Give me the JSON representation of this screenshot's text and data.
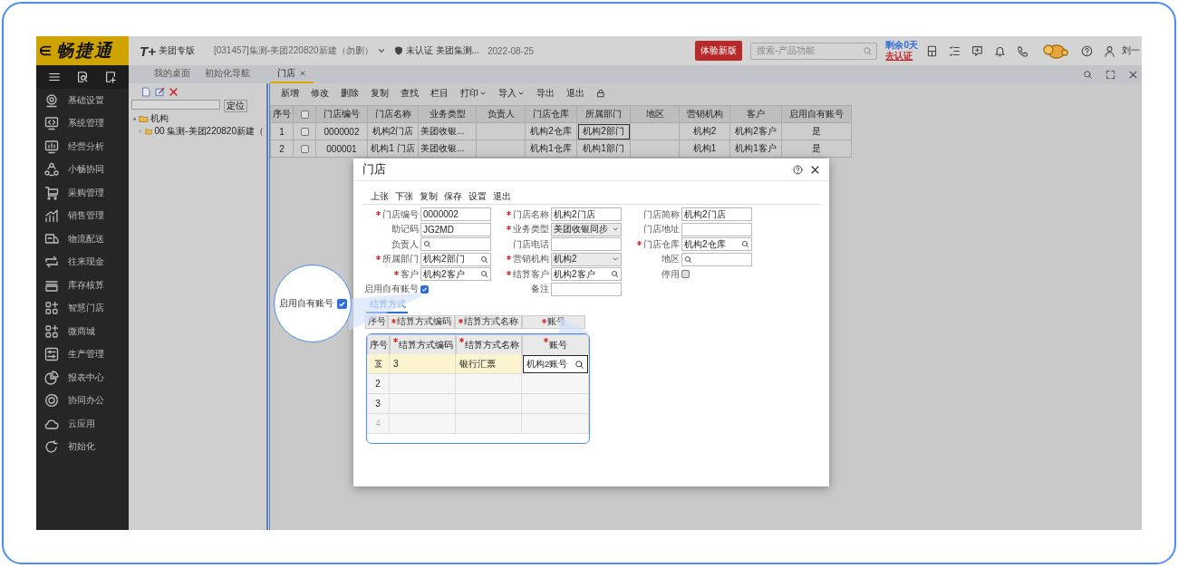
{
  "sidebar": {
    "logo": "畅捷通",
    "items": [
      {
        "label": "基础设置"
      },
      {
        "label": "系统管理"
      },
      {
        "label": "经营分析"
      },
      {
        "label": "小畅协同"
      },
      {
        "label": "采购管理"
      },
      {
        "label": "销售管理"
      },
      {
        "label": "物流配送"
      },
      {
        "label": "往来现金"
      },
      {
        "label": "库存核算"
      },
      {
        "label": "智慧门店"
      },
      {
        "label": "微商城"
      },
      {
        "label": "生产管理"
      },
      {
        "label": "报表中心"
      },
      {
        "label": "协同办公"
      },
      {
        "label": "云应用"
      },
      {
        "label": "初始化"
      }
    ]
  },
  "header": {
    "brand_mark": "T+",
    "edition": "美团专版",
    "account": "[031457]集测-美团220820新建（勿删）",
    "cert_status": "未认证",
    "company": "美团集测...",
    "date": "2022-08-25",
    "trial_button": "体验新版",
    "search": {
      "placeholder": "搜索-产品功能"
    },
    "remaining": "剩余0天",
    "certify_link": "去认证",
    "user": "刘一"
  },
  "tabs": [
    {
      "label": "我的桌面",
      "selected": false,
      "closable": false
    },
    {
      "label": "初始化导航",
      "selected": false,
      "closable": false
    },
    {
      "label": "门店",
      "selected": true,
      "closable": true
    }
  ],
  "tree_panel": {
    "locate_button": "定位",
    "tree": [
      {
        "label": "机构",
        "expanded": true,
        "children": [
          {
            "label": "00 集测-美团220820新建（",
            "expanded": false
          }
        ]
      }
    ]
  },
  "toolbar": [
    {
      "label": "新增",
      "dropdown": false
    },
    {
      "label": "修改",
      "dropdown": false
    },
    {
      "label": "删除",
      "dropdown": false
    },
    {
      "label": "复制",
      "dropdown": false
    },
    {
      "label": "查找",
      "dropdown": false
    },
    {
      "label": "栏目",
      "dropdown": false
    },
    {
      "label": "打印",
      "dropdown": true
    },
    {
      "label": "导入",
      "dropdown": true
    },
    {
      "label": "导出",
      "dropdown": false
    },
    {
      "label": "退出",
      "dropdown": false
    }
  ],
  "table": {
    "columns": [
      {
        "kind": "text",
        "label": "序号"
      },
      {
        "kind": "checkbox",
        "checked": false
      },
      {
        "kind": "text",
        "label": "门店编号"
      },
      {
        "kind": "text",
        "label": "门店名称"
      },
      {
        "kind": "text",
        "label": "业务类型"
      },
      {
        "kind": "text",
        "label": "负责人"
      },
      {
        "kind": "text",
        "label": "门店仓库"
      },
      {
        "kind": "text",
        "label": "所属部门"
      },
      {
        "kind": "text",
        "label": "地区"
      },
      {
        "kind": "text",
        "label": "营销机构"
      },
      {
        "kind": "text",
        "label": "客户"
      },
      {
        "kind": "text",
        "label": "启用自有账号"
      }
    ],
    "rows": [
      {
        "cells": [
          {
            "kind": "text",
            "text": "1",
            "focused": false
          },
          {
            "kind": "checkbox",
            "checked": false
          },
          {
            "kind": "text",
            "text": "0000002",
            "focused": false
          },
          {
            "kind": "text",
            "text": "机构2门店",
            "focused": false
          },
          {
            "kind": "text",
            "text": "美团收银...",
            "focused": false
          },
          {
            "kind": "text",
            "focused": false
          },
          {
            "kind": "text",
            "text": "机构2仓库",
            "focused": false
          },
          {
            "kind": "text",
            "text": "机构2部门",
            "focused": true
          },
          {
            "kind": "text",
            "focused": false
          },
          {
            "kind": "text",
            "text": "机构2",
            "focused": false
          },
          {
            "kind": "text",
            "text": "机构2客户",
            "focused": false
          },
          {
            "kind": "text",
            "text": "是",
            "focused": false
          }
        ]
      },
      {
        "cells": [
          {
            "kind": "text",
            "text": "2",
            "focused": false
          },
          {
            "kind": "checkbox",
            "checked": false
          },
          {
            "kind": "text",
            "text": "000001",
            "focused": false
          },
          {
            "kind": "text",
            "text": "机构1 门店",
            "focused": false
          },
          {
            "kind": "text",
            "text": "美团收银...",
            "focused": false
          },
          {
            "kind": "text",
            "focused": false
          },
          {
            "kind": "text",
            "text": "机构1仓库",
            "focused": false
          },
          {
            "kind": "text",
            "text": "机构1部门",
            "focused": false
          },
          {
            "kind": "text",
            "focused": false
          },
          {
            "kind": "text",
            "text": "机构1",
            "focused": false
          },
          {
            "kind": "text",
            "text": "机构1客户",
            "focused": false
          },
          {
            "kind": "text",
            "text": "是",
            "focused": false
          }
        ]
      }
    ]
  },
  "dialog": {
    "title": "门店",
    "toolbar": [
      "上张",
      "下张",
      "复制",
      "保存",
      "设置",
      "退出"
    ],
    "fields": [
      {
        "label": "门店编号",
        "required": true,
        "kind": "text",
        "value": "0000002"
      },
      {
        "label": "门店名称",
        "required": true,
        "kind": "text",
        "value": "机构2门店"
      },
      {
        "label": "门店简称",
        "required": false,
        "kind": "text",
        "value": "机构2门店"
      },
      {
        "label": "助记码",
        "required": false,
        "kind": "text",
        "value": "JG2MD"
      },
      {
        "label": "业务类型",
        "required": true,
        "kind": "select",
        "value": "美团收银同步"
      },
      {
        "label": "门店地址",
        "required": false,
        "kind": "text"
      },
      {
        "label": "负责人",
        "required": false,
        "kind": "lookup"
      },
      {
        "label": "门店电话",
        "required": false,
        "kind": "text"
      },
      {
        "label": "门店仓库",
        "required": true,
        "kind": "lookup",
        "value": "机构2仓库"
      },
      {
        "label": "所属部门",
        "required": true,
        "kind": "lookup",
        "value": "机构2部门"
      },
      {
        "label": "营销机构",
        "required": true,
        "kind": "select",
        "value": "机构2"
      },
      {
        "label": "地区",
        "required": false,
        "kind": "lookup"
      },
      {
        "label": "客户",
        "required": true,
        "kind": "lookup",
        "value": "机构2客户"
      },
      {
        "label": "结算客户",
        "required": true,
        "kind": "lookup",
        "value": "机构2客户"
      },
      {
        "label": "停用",
        "required": false,
        "kind": "checkbox",
        "checked": false
      },
      {
        "label": "启用自有账号",
        "required": false,
        "kind": "checkbox",
        "checked": true
      },
      {
        "label": "备注",
        "required": false,
        "kind": "text"
      }
    ],
    "tab": "结算方式",
    "grid_columns": [
      {
        "label": "序号",
        "required": false
      },
      {
        "label": "结算方式编码",
        "required": true
      },
      {
        "label": "结算方式名称",
        "required": true
      },
      {
        "label": "账号",
        "required": true
      }
    ]
  },
  "callout": {
    "label": "启用自有账号",
    "checked": true
  },
  "zoom_table": {
    "columns": [
      {
        "label": "序号",
        "required": false
      },
      {
        "label": "结算方式编码",
        "required": true
      },
      {
        "label": "结算方式名称",
        "required": true
      },
      {
        "label": "账号",
        "required": true
      }
    ],
    "rows": [
      {
        "kind": "current",
        "cells": [
          "3",
          "银行汇票",
          "机构2账号"
        ]
      },
      {
        "kind": "row",
        "number": "2",
        "greyed": false
      },
      {
        "kind": "row",
        "number": "3",
        "greyed": false
      },
      {
        "kind": "row",
        "number": "4",
        "greyed": true
      }
    ]
  }
}
